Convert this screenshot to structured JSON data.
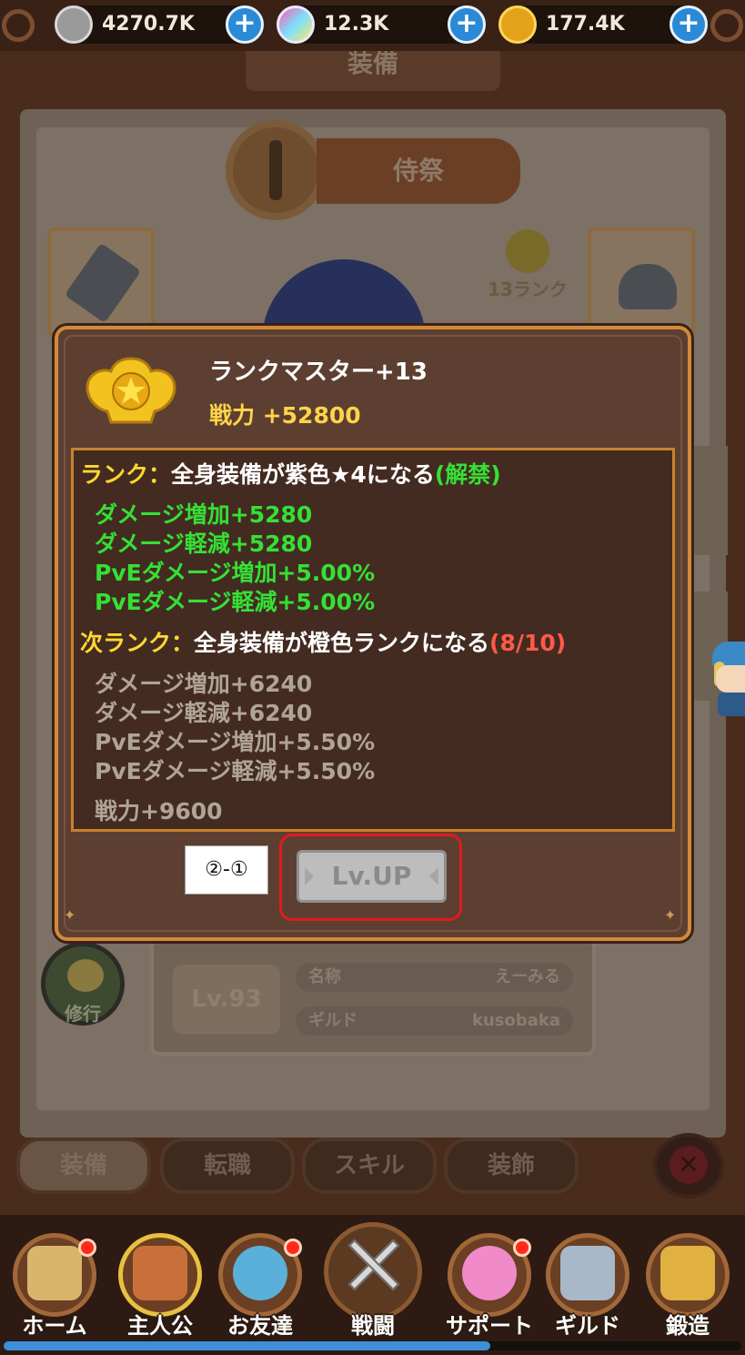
{
  "currencies": [
    {
      "name": "silver",
      "icon": "silver-coin-icon",
      "value": "4270.7K"
    },
    {
      "name": "gem",
      "icon": "rainbow-gem-icon",
      "value": "12.3K"
    },
    {
      "name": "gold",
      "icon": "gold-medal-icon",
      "value": "177.4K"
    }
  ],
  "plus_glyph": "+",
  "background": {
    "title": "装備",
    "class_name": "侍祭",
    "rank_badge": "13ランク",
    "level": "Lv.93",
    "profile": [
      {
        "key": "名称",
        "value": "えーみる"
      },
      {
        "key": "ギルド",
        "value": "kusobaka"
      }
    ],
    "training": "修行",
    "tabs": [
      "装備",
      "転職",
      "スキル",
      "装飾"
    ],
    "close_glyph": "✕"
  },
  "modal": {
    "title": "ランクマスター+13",
    "power": "戦力 +52800",
    "current_rank": {
      "label": "ランク：",
      "condition": "全身装備が紫色★4になる",
      "status": "(解禁)",
      "stats": [
        "ダメージ増加+5280",
        "ダメージ軽減+5280",
        "PvEダメージ増加+5.00%",
        "PvEダメージ軽減+5.00%"
      ]
    },
    "next_rank": {
      "label": "次ランク：",
      "condition": "全身装備が橙色ランクになる",
      "progress": "(8/10)",
      "stats": [
        "ダメージ増加+6240",
        "ダメージ軽減+6240",
        "PvEダメージ増加+5.50%",
        "PvEダメージ軽減+5.50%"
      ],
      "power": "戦力+9600"
    },
    "lvup_button": "Lv.UP",
    "annotation": "②-①"
  },
  "nav": [
    {
      "label": "ホーム",
      "badge": true,
      "color": "#d8b56a"
    },
    {
      "label": "主人公",
      "badge": false,
      "color": "#c8703a"
    },
    {
      "label": "お友達",
      "badge": true,
      "color": "#5ab0d8"
    },
    {
      "label": "戦闘",
      "badge": false,
      "color": "#7a5a30"
    },
    {
      "label": "サポート",
      "badge": true,
      "color": "#f08ac8"
    },
    {
      "label": "ギルド",
      "badge": false,
      "color": "#a8b8c8"
    },
    {
      "label": "鍛造",
      "badge": false,
      "color": "#e0b040"
    }
  ],
  "progress": 0.66,
  "colors": {
    "accent_blue": "#2a8ad6",
    "frame_orange": "#d28a3a",
    "unlocked_green": "#35e035",
    "progress_red": "#ff5a4a",
    "highlight_red": "#e01b1b"
  }
}
